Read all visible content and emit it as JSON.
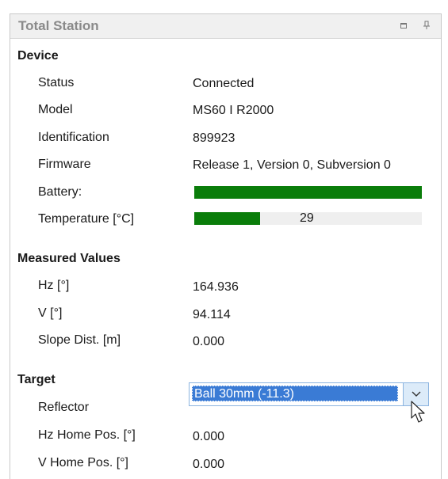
{
  "panel": {
    "title": "Total Station",
    "restore_icon": "restore-icon",
    "pin_icon": "pin-icon"
  },
  "device": {
    "heading": "Device",
    "status_label": "Status",
    "status_value": "Connected",
    "model_label": "Model",
    "model_value": "MS60 I R2000",
    "identification_label": "Identification",
    "identification_value": "899923",
    "firmware_label": "Firmware",
    "firmware_value": "Release 1, Version 0, Subversion 0",
    "battery_label": "Battery:",
    "battery_level": 1.0,
    "temperature_label": "Temperature [°C]",
    "temperature_value": "29",
    "temperature_level": 0.29,
    "bar_color": "#0a7d0a"
  },
  "measured": {
    "heading": "Measured Values",
    "hz_label": "Hz [°]",
    "hz_value": "164.936",
    "v_label": "V [°]",
    "v_value": "94.114",
    "slope_label": "Slope Dist. [m]",
    "slope_value": "0.000"
  },
  "target": {
    "heading": "Target",
    "reflector_label": "Reflector",
    "reflector_value": "Ball 30mm (-11.3)",
    "hz_home_label": "Hz Home Pos. [°]",
    "hz_home_value": "0.000",
    "v_home_label": "V Home Pos. [°]",
    "v_home_value": "0.000"
  }
}
